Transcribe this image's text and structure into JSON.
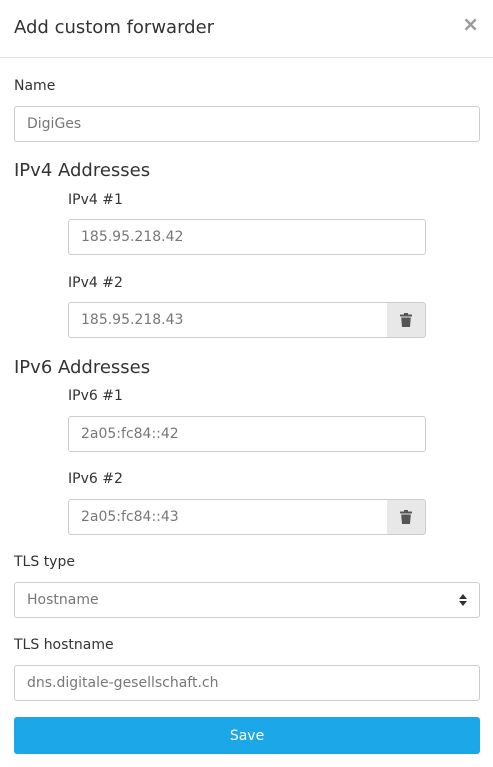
{
  "dialog": {
    "title": "Add custom forwarder",
    "close_glyph": "×"
  },
  "name": {
    "label": "Name",
    "value": "DigiGes"
  },
  "ipv4": {
    "heading": "IPv4 Addresses",
    "items": [
      {
        "label": "IPv4 #1",
        "value": "185.95.218.42"
      },
      {
        "label": "IPv4 #2",
        "value": "185.95.218.43",
        "delete_icon": "trash-icon"
      }
    ]
  },
  "ipv6": {
    "heading": "IPv6 Addresses",
    "items": [
      {
        "label": "IPv6 #1",
        "value": "2a05:fc84::42"
      },
      {
        "label": "IPv6 #2",
        "value": "2a05:fc84::43",
        "delete_icon": "trash-icon"
      }
    ]
  },
  "tls_type": {
    "label": "TLS type",
    "selected": "Hostname"
  },
  "tls_hostname": {
    "label": "TLS hostname",
    "value": "dns.digitale-gesellschaft.ch"
  },
  "save_label": "Save",
  "colors": {
    "accent": "#1ca7e8",
    "border": "#cccccc",
    "delete_bg": "#e8e8e8"
  }
}
